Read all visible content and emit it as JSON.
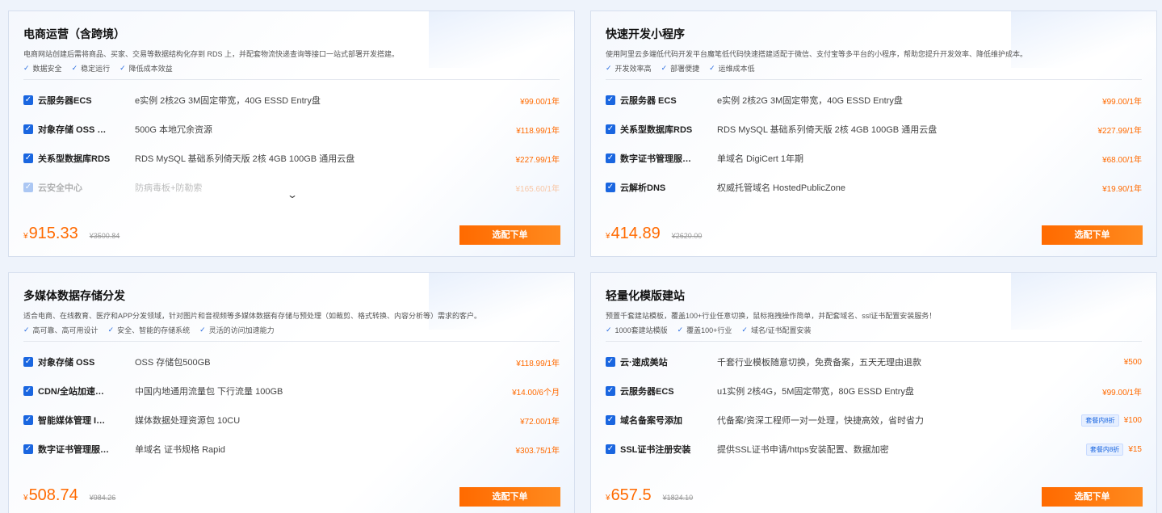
{
  "cards": [
    {
      "title": "电商运营（含跨境）",
      "desc": "电商网站创建后需将商品、买家、交易等数据结构化存到 RDS 上，并配套物流快递查询等接口一站式部署开发搭建。",
      "tags": [
        "数据安全",
        "稳定运行",
        "降低成本效益"
      ],
      "rows": [
        {
          "name": "云服务器ECS",
          "desc": "e实例 2核2G 3M固定带宽，40G ESSD Entry盘",
          "price": "¥99.00/1年"
        },
        {
          "name": "对象存储 OSS …",
          "desc": "500G 本地冗余资源",
          "price": "¥118.99/1年"
        },
        {
          "name": "关系型数据库RDS",
          "desc": "RDS MySQL 基础系列倚天版 2核 4GB 100GB 通用云盘",
          "price": "¥227.99/1年"
        },
        {
          "name": "云安全中心",
          "desc": "防病毒板+防勒索",
          "price": "¥165.60/1年"
        }
      ],
      "more_icon": "chevron-down-icon",
      "currency": "¥",
      "total": "915.33",
      "original": "¥3500.84",
      "button": "选配下单"
    },
    {
      "title": "快速开发小程序",
      "desc": "使用阿里云多端低代码开发平台魔笔低代码快速搭建适配于微信、支付宝等多平台的小程序，帮助您提升开发效率、降低维护成本。",
      "tags": [
        "开发效率高",
        "部署便捷",
        "运维成本低"
      ],
      "rows": [
        {
          "name": "云服务器 ECS",
          "desc": "e实例 2核2G 3M固定带宽，40G ESSD Entry盘",
          "price": "¥99.00/1年"
        },
        {
          "name": "关系型数据库RDS",
          "desc": "RDS MySQL 基础系列倚天版 2核 4GB 100GB 通用云盘",
          "price": "¥227.99/1年"
        },
        {
          "name": "数字证书管理服…",
          "desc": "单域名 DigiCert 1年期",
          "price": "¥68.00/1年"
        },
        {
          "name": "云解析DNS",
          "desc": "权威托管域名 HostedPublicZone",
          "price": "¥19.90/1年"
        }
      ],
      "currency": "¥",
      "total": "414.89",
      "original": "¥2620.00",
      "button": "选配下单"
    },
    {
      "title": "多媒体数据存储分发",
      "desc": "适合电商、在线教育、医疗和APP分发领域，针对图片和音视频等多媒体数据有存储与预处理（如裁剪、格式转换、内容分析等）需求的客户。",
      "tags": [
        "高可靠、高可用设计",
        "安全、智能的存储系统",
        "灵活的访问加速能力"
      ],
      "rows": [
        {
          "name": "对象存储 OSS",
          "desc": "OSS 存储包500GB",
          "price": "¥118.99/1年"
        },
        {
          "name": "CDN/全站加速…",
          "desc": "中国内地通用流量包 下行流量 100GB",
          "price": "¥14.00/6个月"
        },
        {
          "name": "智能媒体管理 I…",
          "desc": "媒体数据处理资源包 10CU",
          "price": "¥72.00/1年"
        },
        {
          "name": "数字证书管理服…",
          "desc": "单域名 证书规格 Rapid",
          "price": "¥303.75/1年"
        }
      ],
      "currency": "¥",
      "total": "508.74",
      "original": "¥984.26",
      "button": "选配下单"
    },
    {
      "title": "轻量化模版建站",
      "desc": "预置千套建站模板，覆盖100+行业任意切换，鼠标拖拽操作简单，并配套域名、ssl证书配置安装服务！",
      "tags": [
        "1000套建站模版",
        "覆盖100+行业",
        "域名/证书配置安装"
      ],
      "rows": [
        {
          "name": "云·速成美站",
          "desc": "千套行业模板随意切换，免费备案，五天无理由退款",
          "price": "¥500"
        },
        {
          "name": "云服务器ECS",
          "desc": "u1实例 2核4G，5M固定带宽，80G ESSD Entry盘",
          "price": "¥99.00/1年"
        },
        {
          "name": "域名备案号添加",
          "desc": "代备案/资深工程师一对一处理，快捷高效，省时省力",
          "price": "¥100",
          "badge": "套餐内8折"
        },
        {
          "name": "SSL证书注册安装",
          "desc": "提供SSL证书申请/https安装配置、数据加密",
          "price": "¥15",
          "badge": "套餐内8折"
        }
      ],
      "currency": "¥",
      "total": "657.5",
      "original": "¥1824.10",
      "button": "选配下单"
    }
  ]
}
